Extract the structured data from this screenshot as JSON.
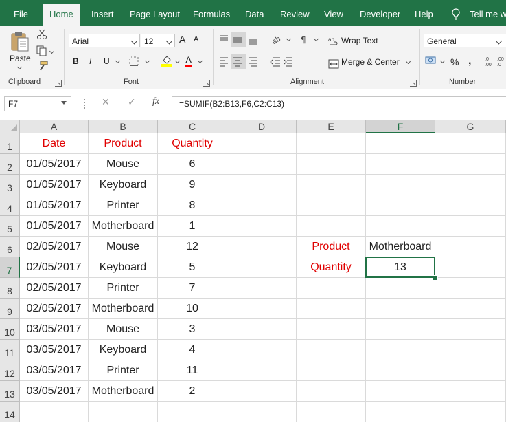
{
  "ribbon_tabs": [
    "File",
    "Home",
    "Insert",
    "Page Layout",
    "Formulas",
    "Data",
    "Review",
    "View",
    "Developer",
    "Help",
    "Tell me wh"
  ],
  "active_tab": "Home",
  "clipboard": {
    "paste_label": "Paste",
    "group_label": "Clipboard"
  },
  "font": {
    "name": "Arial",
    "size": "12",
    "grow": "A",
    "shrink": "A",
    "bold": "B",
    "italic": "I",
    "underline": "U",
    "font_color_letter": "A",
    "font_color": "#ff0000",
    "fill_color": "#ffff00",
    "group_label": "Font"
  },
  "alignment": {
    "wrap_text": "Wrap Text",
    "merge_center": "Merge & Center",
    "group_label": "Alignment"
  },
  "number": {
    "format": "General",
    "percent": "%",
    "comma": ",",
    "group_label": "Number"
  },
  "formula_bar": {
    "name_box": "F7",
    "cancel": "✕",
    "enter": "✓",
    "fx": "fx",
    "formula": "=SUMIF(B2:B13,F6,C2:C13)"
  },
  "columns": [
    "A",
    "B",
    "C",
    "D",
    "E",
    "F",
    "G"
  ],
  "rows": [
    "1",
    "2",
    "3",
    "4",
    "5",
    "6",
    "7",
    "8",
    "9",
    "10",
    "11",
    "12",
    "13",
    "14"
  ],
  "table": {
    "headers": [
      "Date",
      "Product",
      "Quantity"
    ],
    "rows": [
      [
        "01/05/2017",
        "Mouse",
        "6"
      ],
      [
        "01/05/2017",
        "Keyboard",
        "9"
      ],
      [
        "01/05/2017",
        "Printer",
        "8"
      ],
      [
        "01/05/2017",
        "Motherboard",
        "1"
      ],
      [
        "02/05/2017",
        "Mouse",
        "12"
      ],
      [
        "02/05/2017",
        "Keyboard",
        "5"
      ],
      [
        "02/05/2017",
        "Printer",
        "7"
      ],
      [
        "02/05/2017",
        "Motherboard",
        "10"
      ],
      [
        "03/05/2017",
        "Mouse",
        "3"
      ],
      [
        "03/05/2017",
        "Keyboard",
        "4"
      ],
      [
        "03/05/2017",
        "Printer",
        "11"
      ],
      [
        "03/05/2017",
        "Motherboard",
        "2"
      ]
    ]
  },
  "criteria": {
    "product_label": "Product",
    "product_value": "Motherboard",
    "quantity_label": "Quantity",
    "quantity_value": "13"
  },
  "colors": {
    "accent": "#217346",
    "header_text": "#e00000"
  },
  "selected_cell": "F7"
}
